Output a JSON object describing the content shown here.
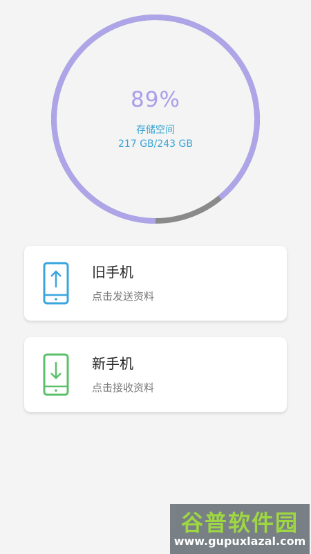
{
  "storage": {
    "percent_text": "89%",
    "label": "存储空间",
    "usage_text": "217 GB/243 GB",
    "used_fraction": 0.89,
    "used_color": "#ada5e8",
    "free_color": "#8a8a8a"
  },
  "cards": [
    {
      "title": "旧手机",
      "desc": "点击发送资料",
      "icon": "phone-upload-icon",
      "color": "#3aa4dc"
    },
    {
      "title": "新手机",
      "desc": "点击接收资料",
      "icon": "phone-download-icon",
      "color": "#5cc06a"
    }
  ],
  "watermark": {
    "name": "谷普软件园",
    "url": "www.gupuxlazal.com"
  }
}
